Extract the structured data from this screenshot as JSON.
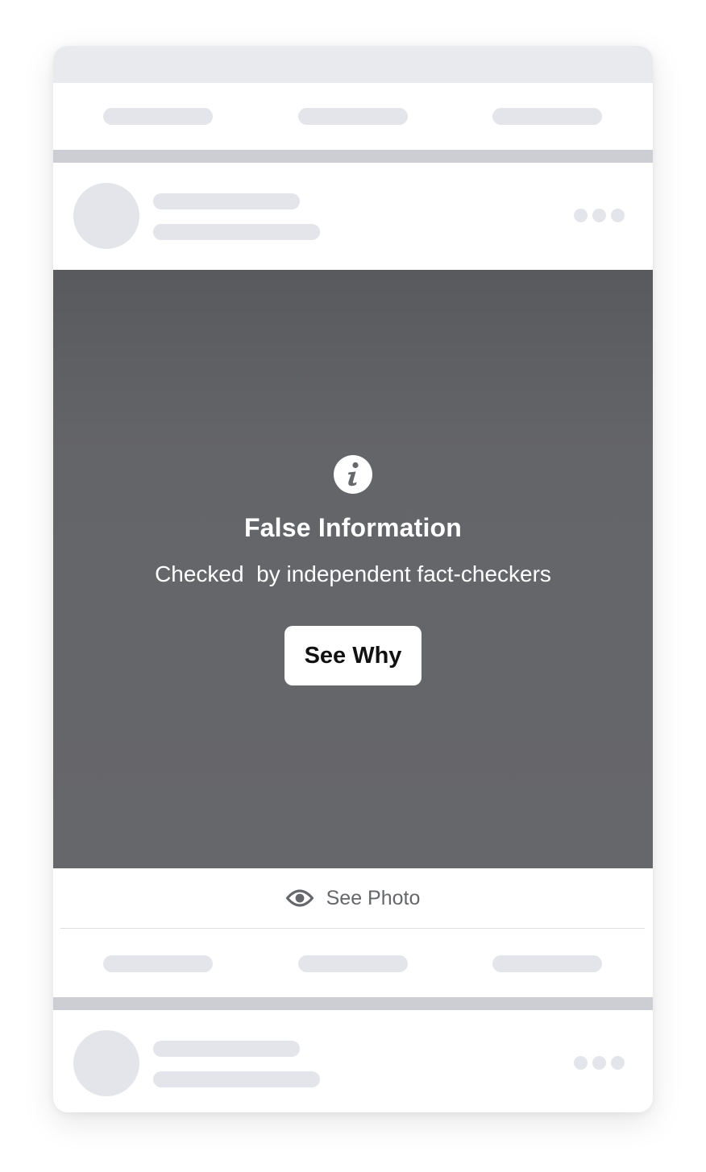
{
  "overlay": {
    "title": "False Information",
    "subtitle": "Checked  by independent fact-checkers",
    "button_label": "See Why",
    "icon": "info-icon"
  },
  "reveal": {
    "label": "See Photo",
    "icon": "eye-icon"
  },
  "colors": {
    "placeholder": "#e4e5ea",
    "divider": "#cdced4",
    "overlay": "#66676b",
    "muted_text": "#65676b"
  }
}
